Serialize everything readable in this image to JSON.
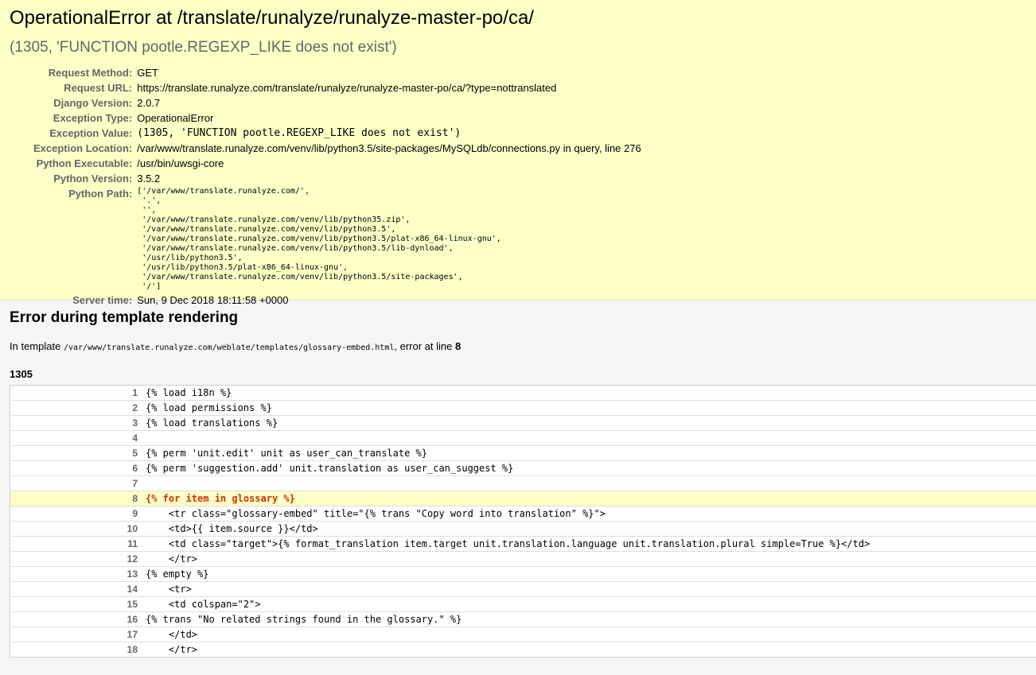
{
  "summary": {
    "title": "OperationalError at /translate/runalyze/runalyze-master-po/ca/",
    "subtitle": "(1305, 'FUNCTION pootle.REGEXP_LIKE does not exist')",
    "meta": [
      {
        "label": "Request Method:",
        "value": "GET",
        "mono": false
      },
      {
        "label": "Request URL:",
        "value": "https://translate.runalyze.com/translate/runalyze/runalyze-master-po/ca/?type=nottranslated",
        "mono": false
      },
      {
        "label": "Django Version:",
        "value": "2.0.7",
        "mono": false
      },
      {
        "label": "Exception Type:",
        "value": "OperationalError",
        "mono": false
      },
      {
        "label": "Exception Value:",
        "value": "(1305, 'FUNCTION pootle.REGEXP_LIKE does not exist')",
        "mono": true
      },
      {
        "label": "Exception Location:",
        "value": "/var/www/translate.runalyze.com/venv/lib/python3.5/site-packages/MySQLdb/connections.py in query, line 276",
        "mono": false
      },
      {
        "label": "Python Executable:",
        "value": "/usr/bin/uwsgi-core",
        "mono": false
      },
      {
        "label": "Python Version:",
        "value": "3.5.2",
        "mono": false
      }
    ],
    "python_path_label": "Python Path:",
    "python_path": "['/var/www/translate.runalyze.com/',\n '.',\n '',\n '/var/www/translate.runalyze.com/venv/lib/python35.zip',\n '/var/www/translate.runalyze.com/venv/lib/python3.5',\n '/var/www/translate.runalyze.com/venv/lib/python3.5/plat-x86_64-linux-gnu',\n '/var/www/translate.runalyze.com/venv/lib/python3.5/lib-dynload',\n '/usr/lib/python3.5',\n '/usr/lib/python3.5/plat-x86_64-linux-gnu',\n '/var/www/translate.runalyze.com/venv/lib/python3.5/site-packages',\n '/']",
    "server_time_label": "Server time:",
    "server_time": "Sun, 9 Dec 2018 18:11:58 +0000"
  },
  "template": {
    "heading": "Error during template rendering",
    "in_template_prefix": "In template ",
    "template_path": "/var/www/translate.runalyze.com/weblate/templates/glossary-embed.html",
    "error_at_text": ", error at line ",
    "error_line": "8",
    "error_number": "1305",
    "lines": [
      {
        "num": "1",
        "code": "{% load i18n %}",
        "error": false
      },
      {
        "num": "2",
        "code": "{% load permissions %}",
        "error": false
      },
      {
        "num": "3",
        "code": "{% load translations %}",
        "error": false
      },
      {
        "num": "4",
        "code": "",
        "error": false
      },
      {
        "num": "5",
        "code": "{% perm 'unit.edit' unit as user_can_translate %}",
        "error": false
      },
      {
        "num": "6",
        "code": "{% perm 'suggestion.add' unit.translation as user_can_suggest %}",
        "error": false
      },
      {
        "num": "7",
        "code": "",
        "error": false
      },
      {
        "num": "8",
        "code": "{% for item in glossary %}",
        "error": true
      },
      {
        "num": "9",
        "code": "    <tr class=\"glossary-embed\" title=\"{% trans \"Copy word into translation\" %}\">",
        "error": false
      },
      {
        "num": "10",
        "code": "    <td>{{ item.source }}</td>",
        "error": false
      },
      {
        "num": "11",
        "code": "    <td class=\"target\">{% format_translation item.target unit.translation.language unit.translation.plural simple=True %}</td>",
        "error": false
      },
      {
        "num": "12",
        "code": "    </tr>",
        "error": false
      },
      {
        "num": "13",
        "code": "{% empty %}",
        "error": false
      },
      {
        "num": "14",
        "code": "    <tr>",
        "error": false
      },
      {
        "num": "15",
        "code": "    <td colspan=\"2\">",
        "error": false
      },
      {
        "num": "16",
        "code": "{% trans \"No related strings found in the glossary.\" %}",
        "error": false
      },
      {
        "num": "17",
        "code": "    </td>",
        "error": false
      },
      {
        "num": "18",
        "code": "    </tr>",
        "error": false
      }
    ]
  }
}
